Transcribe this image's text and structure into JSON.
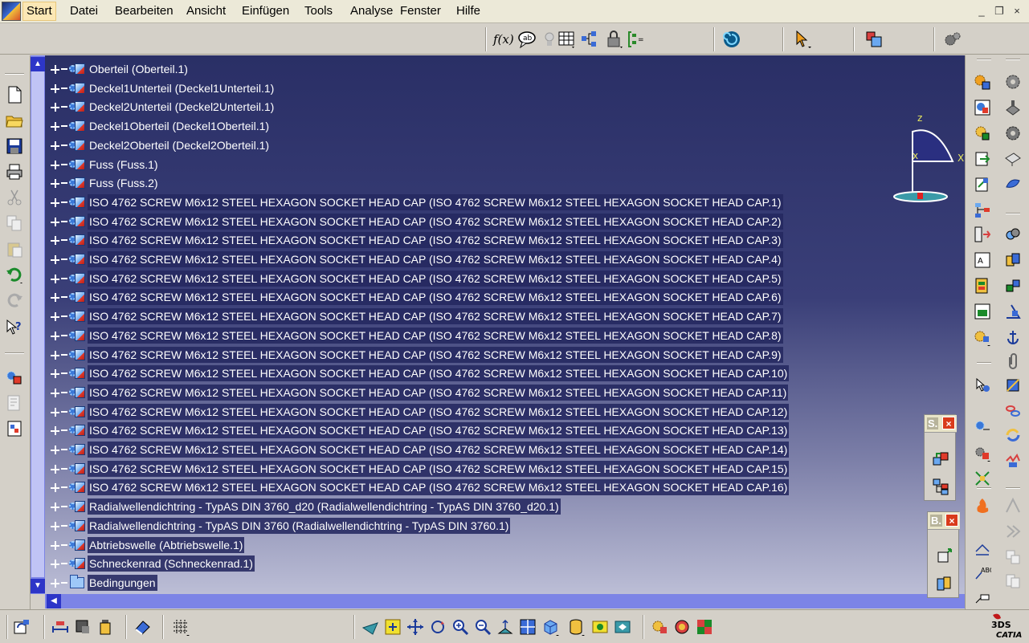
{
  "menu": {
    "items": [
      {
        "key": "start",
        "label": "Start"
      },
      {
        "key": "datei",
        "label": "Datei"
      },
      {
        "key": "bearbeiten",
        "label": "Bearbeiten"
      },
      {
        "key": "ansicht",
        "label": "Ansicht"
      },
      {
        "key": "einfuegen",
        "label": "Einfügen"
      },
      {
        "key": "tools",
        "label": "Tools"
      },
      {
        "key": "analyse",
        "label": "Analyse"
      },
      {
        "key": "fenster",
        "label": "Fenster"
      },
      {
        "key": "hilfe",
        "label": "Hilfe"
      }
    ]
  },
  "window_controls": {
    "minimize": "_",
    "restore": "❐",
    "close": "×"
  },
  "compass": {
    "x_label": "x",
    "x_label2": "X",
    "z_label": "z"
  },
  "tree": {
    "items": [
      "Oberteil (Oberteil.1)",
      "Deckel1Unterteil (Deckel1Unterteil.1)",
      "Deckel2Unterteil (Deckel2Unterteil.1)",
      "Deckel1Oberteil (Deckel1Oberteil.1)",
      "Deckel2Oberteil (Deckel2Oberteil.1)",
      "Fuss (Fuss.1)",
      "Fuss (Fuss.2)",
      "ISO 4762 SCREW M6x12 STEEL HEXAGON SOCKET HEAD CAP (ISO 4762 SCREW M6x12 STEEL HEXAGON SOCKET HEAD CAP.1)",
      "ISO 4762 SCREW M6x12 STEEL HEXAGON SOCKET HEAD CAP (ISO 4762 SCREW M6x12 STEEL HEXAGON SOCKET HEAD CAP.2)",
      "ISO 4762 SCREW M6x12 STEEL HEXAGON SOCKET HEAD CAP (ISO 4762 SCREW M6x12 STEEL HEXAGON SOCKET HEAD CAP.3)",
      "ISO 4762 SCREW M6x12 STEEL HEXAGON SOCKET HEAD CAP (ISO 4762 SCREW M6x12 STEEL HEXAGON SOCKET HEAD CAP.4)",
      "ISO 4762 SCREW M6x12 STEEL HEXAGON SOCKET HEAD CAP (ISO 4762 SCREW M6x12 STEEL HEXAGON SOCKET HEAD CAP.5)",
      "ISO 4762 SCREW M6x12 STEEL HEXAGON SOCKET HEAD CAP (ISO 4762 SCREW M6x12 STEEL HEXAGON SOCKET HEAD CAP.6)",
      "ISO 4762 SCREW M6x12 STEEL HEXAGON SOCKET HEAD CAP (ISO 4762 SCREW M6x12 STEEL HEXAGON SOCKET HEAD CAP.7)",
      "ISO 4762 SCREW M6x12 STEEL HEXAGON SOCKET HEAD CAP (ISO 4762 SCREW M6x12 STEEL HEXAGON SOCKET HEAD CAP.8)",
      "ISO 4762 SCREW M6x12 STEEL HEXAGON SOCKET HEAD CAP (ISO 4762 SCREW M6x12 STEEL HEXAGON SOCKET HEAD CAP.9)",
      "ISO 4762 SCREW M6x12 STEEL HEXAGON SOCKET HEAD CAP (ISO 4762 SCREW M6x12 STEEL HEXAGON SOCKET HEAD CAP.10)",
      "ISO 4762 SCREW M6x12 STEEL HEXAGON SOCKET HEAD CAP (ISO 4762 SCREW M6x12 STEEL HEXAGON SOCKET HEAD CAP.11)",
      "ISO 4762 SCREW M6x12 STEEL HEXAGON SOCKET HEAD CAP (ISO 4762 SCREW M6x12 STEEL HEXAGON SOCKET HEAD CAP.12)",
      "ISO 4762 SCREW M6x12 STEEL HEXAGON SOCKET HEAD CAP (ISO 4762 SCREW M6x12 STEEL HEXAGON SOCKET HEAD CAP.13)",
      "ISO 4762 SCREW M6x12 STEEL HEXAGON SOCKET HEAD CAP (ISO 4762 SCREW M6x12 STEEL HEXAGON SOCKET HEAD CAP.14)",
      "ISO 4762 SCREW M6x12 STEEL HEXAGON SOCKET HEAD CAP (ISO 4762 SCREW M6x12 STEEL HEXAGON SOCKET HEAD CAP.15)",
      "ISO 4762 SCREW M6x12 STEEL HEXAGON SOCKET HEAD CAP (ISO 4762 SCREW M6x12 STEEL HEXAGON SOCKET HEAD CAP.16)",
      "Radialwellendichtring - TypAS DIN 3760_d20 (Radialwellendichtring - TypAS DIN 3760_d20.1)",
      "Radialwellendichtring - TypAS DIN 3760 (Radialwellendichtring - TypAS DIN 3760.1)",
      "Abtriebswelle (Abtriebswelle.1)",
      "Schneckenrad (Schneckenrad.1)",
      "Bedingungen"
    ]
  },
  "float_toolbars": {
    "s": {
      "title": "S.",
      "close": "×"
    },
    "b": {
      "title": "B.",
      "close": "×"
    }
  },
  "toolbar": {
    "formula_label": "f(x)"
  },
  "logo": {
    "top": "3DS",
    "bottom": "CATIA"
  }
}
